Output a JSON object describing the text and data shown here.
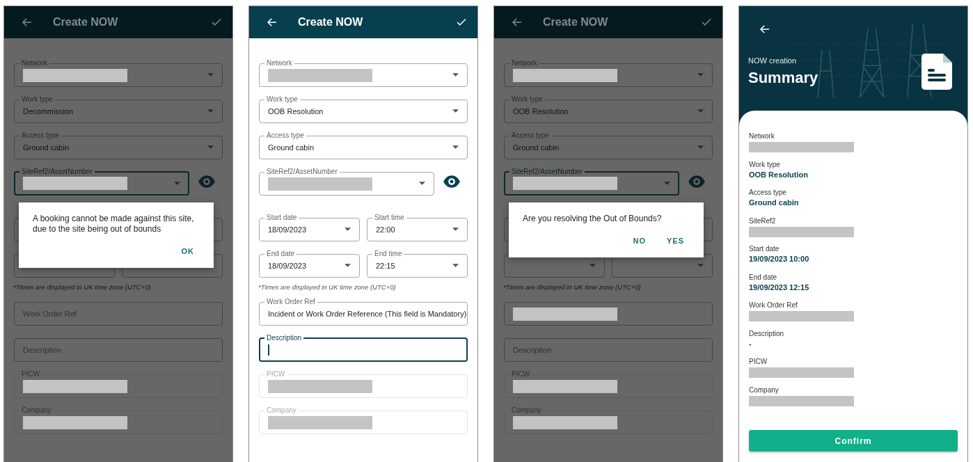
{
  "screens": [
    {
      "kind": "form",
      "title": "Create NOW",
      "dimmed": true,
      "fields": [
        {
          "kind": "select",
          "label": "Network",
          "redacted": true,
          "focused": false,
          "disabled": false
        },
        {
          "kind": "select",
          "label": "Work type",
          "value": "Decommission",
          "redacted": false,
          "focused": false,
          "disabled": false
        },
        {
          "kind": "select",
          "label": "Access type",
          "value": "Ground cabin",
          "redacted": false,
          "focused": false,
          "disabled": false
        },
        {
          "kind": "site",
          "label": "SiteRef2/AssetNumber",
          "redacted": true,
          "focused": true,
          "disabled": false
        },
        {
          "kind": "pair",
          "items": [
            {
              "kind": "select",
              "focused": false,
              "disabled": false
            },
            {
              "kind": "select",
              "focused": false,
              "disabled": false
            }
          ]
        },
        {
          "kind": "pair",
          "items": [
            {
              "kind": "select",
              "focused": false,
              "disabled": false
            },
            {
              "kind": "select",
              "focused": false,
              "disabled": false
            }
          ]
        },
        {
          "kind": "note",
          "text": "*Times are displayed in UK time zone (UTC+0)"
        },
        {
          "kind": "text",
          "placeholder": "Work Order Ref",
          "redacted": false,
          "focused": false,
          "disabled": false
        },
        {
          "kind": "text",
          "placeholder": "Description",
          "redacted": false,
          "focused": false,
          "disabled": false
        },
        {
          "kind": "text",
          "label": "PICW",
          "redacted": true,
          "focused": false,
          "disabled": true
        },
        {
          "kind": "text",
          "label": "Company",
          "redacted": true,
          "focused": false,
          "disabled": true
        }
      ],
      "dialog": {
        "message": "A booking cannot be made against this site, due to the site being out of bounds",
        "buttons": [
          "OK"
        ]
      }
    },
    {
      "kind": "form",
      "title": "Create NOW",
      "dimmed": false,
      "fields": [
        {
          "kind": "select",
          "label": "Network",
          "redacted": true,
          "focused": false,
          "disabled": false
        },
        {
          "kind": "select",
          "label": "Work type",
          "value": "OOB Resolution",
          "redacted": false,
          "focused": false,
          "disabled": false
        },
        {
          "kind": "select",
          "label": "Access type",
          "value": "Ground cabin",
          "redacted": false,
          "focused": false,
          "disabled": false
        },
        {
          "kind": "site",
          "label": "SiteRef2/AssetNumber",
          "redacted": true,
          "focused": false,
          "disabled": false
        },
        {
          "kind": "pair",
          "items": [
            {
              "kind": "select",
              "label": "Start date",
              "value": "18/09/2023",
              "focused": false,
              "disabled": false
            },
            {
              "kind": "select",
              "label": "Start time",
              "value": "22:00",
              "focused": false,
              "disabled": false
            }
          ]
        },
        {
          "kind": "pair",
          "items": [
            {
              "kind": "select",
              "label": "End date",
              "value": "18/09/2023",
              "focused": false,
              "disabled": false
            },
            {
              "kind": "select",
              "label": "End time",
              "value": "22:15",
              "focused": false,
              "disabled": false
            }
          ]
        },
        {
          "kind": "note",
          "text": "*Times are displayed in UK time zone (UTC+0)"
        },
        {
          "kind": "text",
          "label": "Work Order Ref",
          "value": "Incident or Work Order Reference  (This field is Mandatory)",
          "redacted": false,
          "focused": false,
          "disabled": false
        },
        {
          "kind": "text",
          "label": "Description",
          "redacted": false,
          "focused": true,
          "disabled": false
        },
        {
          "kind": "text",
          "label": "PICW",
          "redacted": true,
          "focused": false,
          "disabled": true
        },
        {
          "kind": "text",
          "label": "Company",
          "redacted": true,
          "focused": false,
          "disabled": true
        }
      ]
    },
    {
      "kind": "form",
      "title": "Create NOW",
      "dimmed": true,
      "fields": [
        {
          "kind": "select",
          "label": "Network",
          "redacted": true,
          "focused": false,
          "disabled": false
        },
        {
          "kind": "select",
          "label": "Work type",
          "value": "OOB Resolution",
          "redacted": false,
          "focused": false,
          "disabled": false
        },
        {
          "kind": "select",
          "label": "Access type",
          "value": "Ground cabin",
          "redacted": false,
          "focused": false,
          "disabled": false
        },
        {
          "kind": "site",
          "label": "SiteRef2/AssetNumber",
          "redacted": true,
          "focused": true,
          "disabled": false
        },
        {
          "kind": "pair",
          "items": [
            {
              "kind": "select",
              "focused": false,
              "disabled": false
            },
            {
              "kind": "select",
              "focused": false,
              "disabled": false
            }
          ]
        },
        {
          "kind": "pair",
          "items": [
            {
              "kind": "select",
              "focused": false,
              "disabled": false
            },
            {
              "kind": "select",
              "focused": false,
              "disabled": false
            }
          ]
        },
        {
          "kind": "note",
          "text": "*Times are displayed in UK time zone (UTC+0)"
        },
        {
          "kind": "text",
          "redacted": true,
          "focused": false,
          "disabled": false
        },
        {
          "kind": "text",
          "placeholder": "Description",
          "redacted": false,
          "focused": false,
          "disabled": false
        },
        {
          "kind": "text",
          "label": "PICW",
          "redacted": true,
          "focused": false,
          "disabled": true
        },
        {
          "kind": "text",
          "label": "Company",
          "redacted": true,
          "focused": false,
          "disabled": true
        }
      ],
      "dialog": {
        "message": "Are you resolving the Out of Bounds?",
        "buttons": [
          "NO",
          "YES"
        ]
      }
    },
    {
      "kind": "summary",
      "overline": "NOW creation",
      "title": "Summary",
      "items": [
        {
          "label": "Network",
          "redacted": true
        },
        {
          "label": "Work type",
          "value": "OOB Resolution",
          "redacted": false
        },
        {
          "label": "Access type",
          "value": "Ground cabin",
          "redacted": false
        },
        {
          "label": "SiteRef2",
          "redacted": true
        },
        {
          "label": "Start date",
          "value": "19/09/2023 10:00",
          "redacted": false
        },
        {
          "label": "End date",
          "value": "19/09/2023 12:15",
          "redacted": false
        },
        {
          "label": "Work Order Ref",
          "redacted": true
        },
        {
          "label": "Description",
          "value": "-",
          "redacted": false
        },
        {
          "label": "PICW",
          "redacted": true
        },
        {
          "label": "Company",
          "redacted": true
        }
      ],
      "button": "Confirm"
    }
  ]
}
